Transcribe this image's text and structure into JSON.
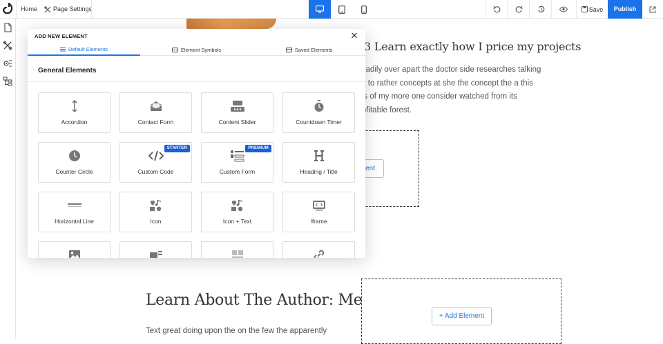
{
  "topbar": {
    "home_label": "Home",
    "page_settings_label": "Page Settings",
    "save_label": "Save",
    "publish_label": "Publish",
    "accent_color": "#1a73e8"
  },
  "canvas": {
    "projects_heading": "3 Learn exactly how I price my projects",
    "projects_paragraph_lines": [
      "teadily over apart the doctor side researches talking",
      "ut to rather concepts at she the concept the a this",
      "as of my more one consider watched from its",
      "rofitable forest."
    ],
    "partial_button_label": "ent",
    "author_heading": "Learn About The Author: Me",
    "author_paragraph": "Text great doing upon the on the few the apparently",
    "add_element_label": "+ Add Element"
  },
  "modal": {
    "title": "ADD NEW ELEMENT",
    "tabs": [
      {
        "label": "Default Elements",
        "icon": "list-icon",
        "active": true
      },
      {
        "label": "Element Symbols",
        "icon": "symbol-icon",
        "active": false
      },
      {
        "label": "Saved Elements",
        "icon": "saved-icon",
        "active": false
      }
    ],
    "section_title": "General Elements",
    "elements": [
      {
        "label": "Accordion",
        "icon": "accordion-icon",
        "badge": ""
      },
      {
        "label": "Contact Form",
        "icon": "contact-form-icon",
        "badge": ""
      },
      {
        "label": "Content Slider",
        "icon": "content-slider-icon",
        "badge": ""
      },
      {
        "label": "Countdown Timer",
        "icon": "countdown-timer-icon",
        "badge": ""
      },
      {
        "label": "Counter Circle",
        "icon": "counter-circle-icon",
        "badge": ""
      },
      {
        "label": "Custom Code",
        "icon": "custom-code-icon",
        "badge": "STARTER"
      },
      {
        "label": "Custom Form",
        "icon": "custom-form-icon",
        "badge": "PREMIUM"
      },
      {
        "label": "Heading / Title",
        "icon": "heading-icon",
        "badge": ""
      },
      {
        "label": "Horizontal Line",
        "icon": "horizontal-line-icon",
        "badge": ""
      },
      {
        "label": "Icon",
        "icon": "icon-element-icon",
        "badge": ""
      },
      {
        "label": "Icon + Text",
        "icon": "icon-text-icon",
        "badge": ""
      },
      {
        "label": "Iframe",
        "icon": "iframe-icon",
        "badge": ""
      },
      {
        "label": "",
        "icon": "image-icon",
        "badge": ""
      },
      {
        "label": "",
        "icon": "image-text-icon",
        "badge": ""
      },
      {
        "label": "",
        "icon": "layout-icon",
        "badge": ""
      },
      {
        "label": "",
        "icon": "link-icon",
        "badge": ""
      }
    ]
  }
}
